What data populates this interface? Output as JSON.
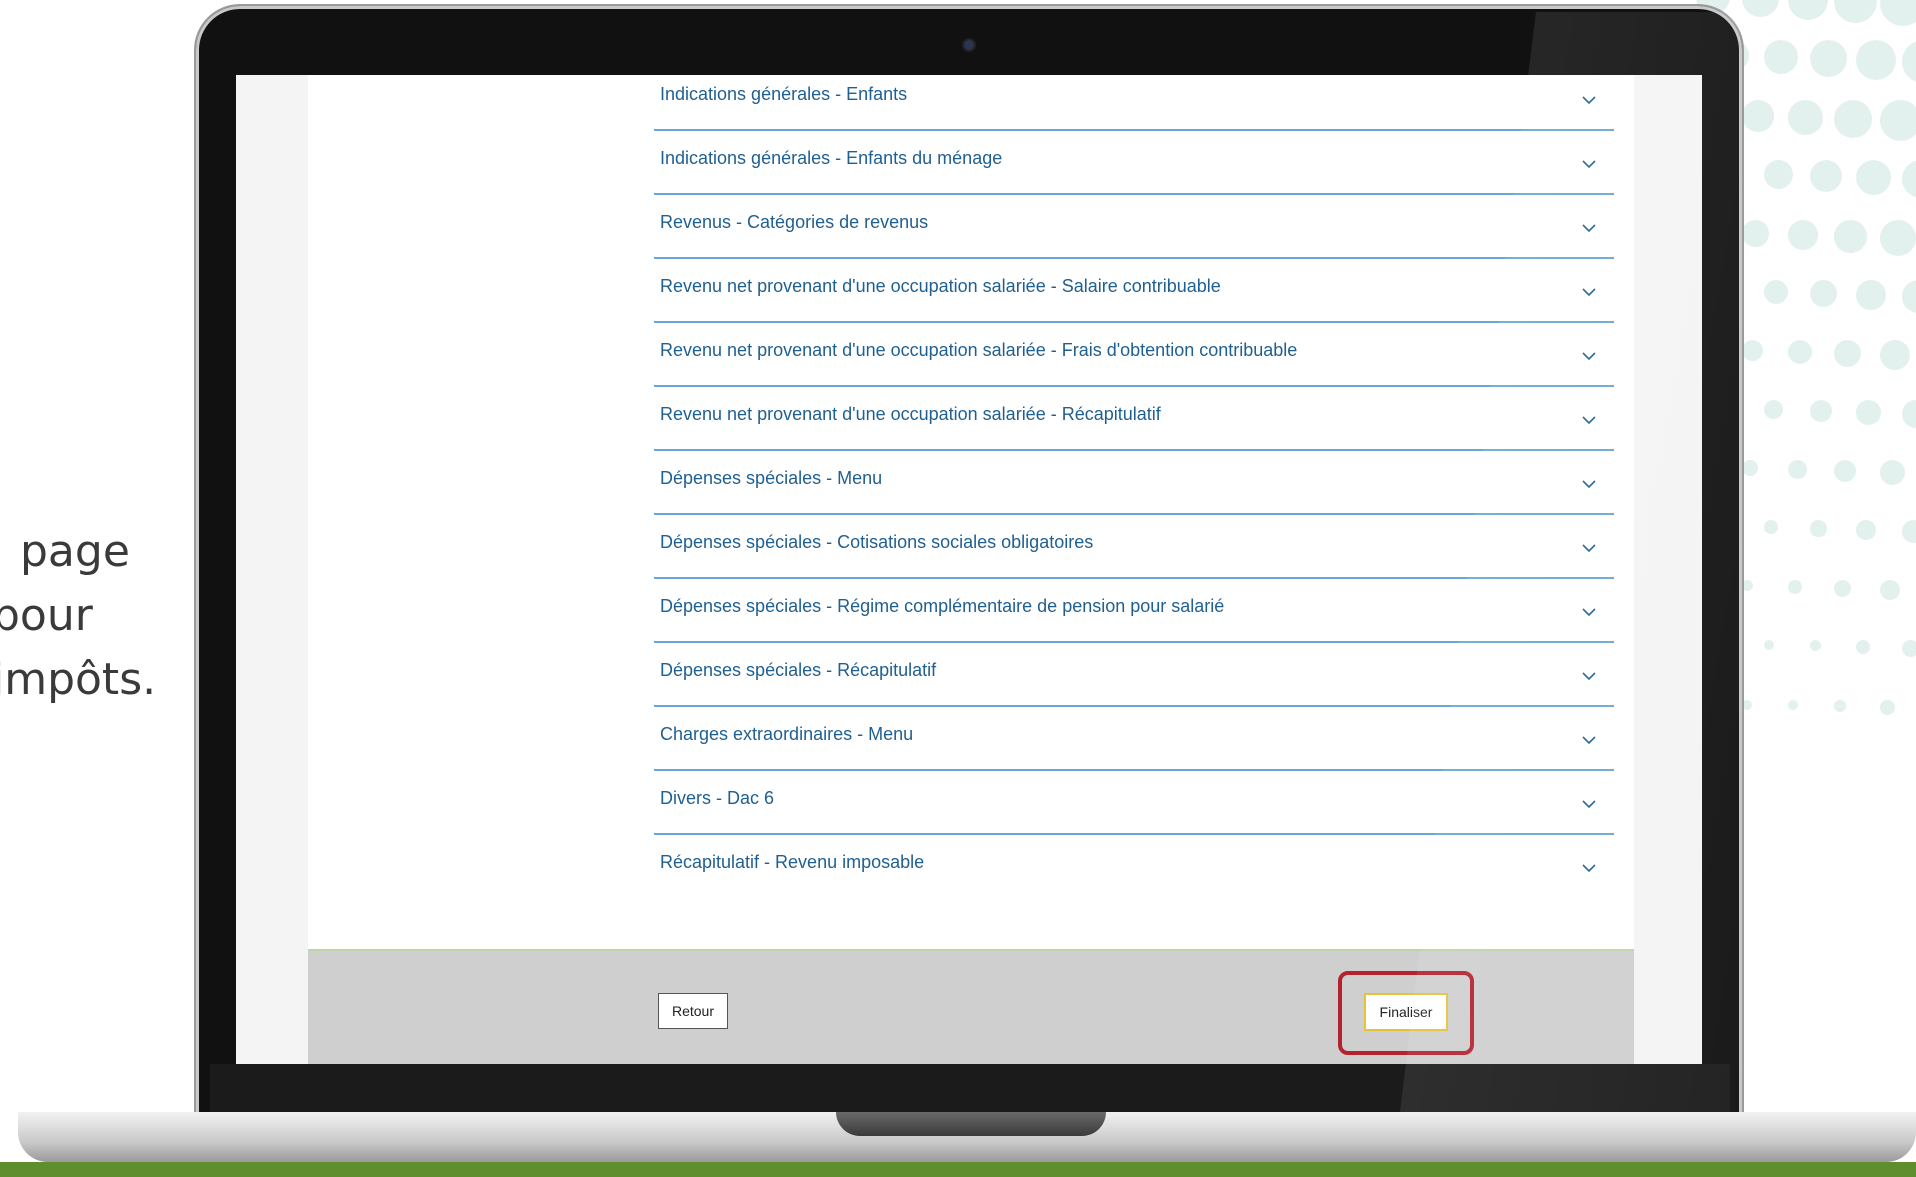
{
  "caption": {
    "lines": [
      "page",
      "pour",
      "impôts."
    ]
  },
  "accordion": {
    "items": [
      "Indications générales - Enfants",
      "Indications générales - Enfants du ménage",
      "Revenus - Catégories de revenus",
      "Revenu net provenant d'une occupation salariée - Salaire contribuable",
      "Revenu net provenant d'une occupation salariée - Frais d'obtention contribuable",
      "Revenu net provenant d'une occupation salariée - Récapitulatif",
      "Dépenses spéciales - Menu",
      "Dépenses spéciales - Cotisations sociales obligatoires",
      "Dépenses spéciales - Régime complémentaire de pension pour salarié",
      "Dépenses spéciales - Récapitulatif",
      "Charges extraordinaires - Menu",
      "Divers - Dac 6",
      "Récapitulatif - Revenu imposable"
    ],
    "icon": "chevron-down-icon"
  },
  "footer": {
    "back_label": "Retour",
    "finalize_label": "Finaliser"
  },
  "colors": {
    "link": "#1f5f92",
    "divider": "#6aa6cf",
    "highlight": "#b3232f",
    "footer_bg": "#cfcfcf",
    "ground": "#5e8e2e"
  }
}
